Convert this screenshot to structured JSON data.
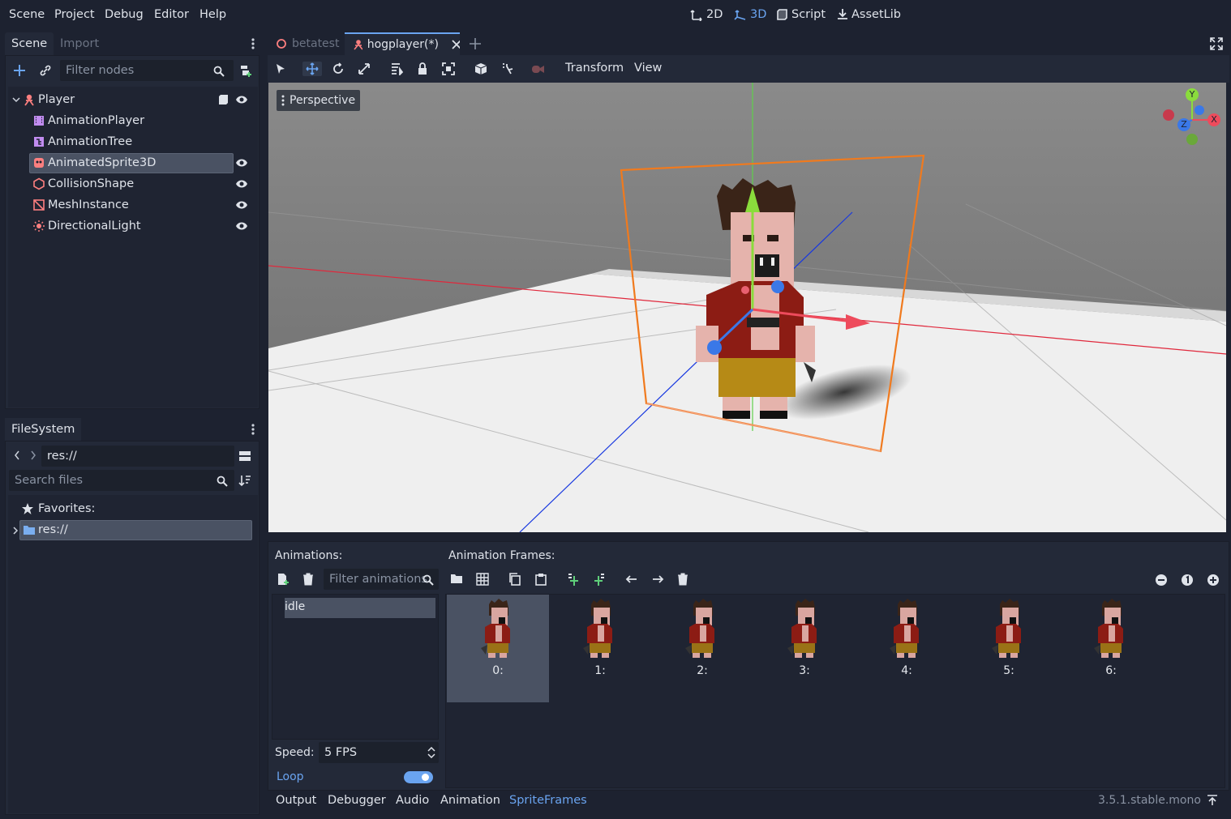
{
  "menu": {
    "scene": "Scene",
    "project": "Project",
    "debug": "Debug",
    "editor": "Editor",
    "help": "Help"
  },
  "workspaces": {
    "w2d": "2D",
    "w3d": "3D",
    "script": "Script",
    "assetlib": "AssetLib"
  },
  "scene_dock": {
    "tab_scene": "Scene",
    "tab_import": "Import",
    "filter_placeholder": "Filter nodes",
    "nodes": [
      {
        "label": "Player",
        "icon": "kinematic-body-icon"
      },
      {
        "label": "AnimationPlayer",
        "icon": "animation-player-icon"
      },
      {
        "label": "AnimationTree",
        "icon": "animation-tree-icon"
      },
      {
        "label": "AnimatedSprite3D",
        "icon": "animated-sprite-icon"
      },
      {
        "label": "CollisionShape",
        "icon": "collision-shape-icon"
      },
      {
        "label": "MeshInstance",
        "icon": "mesh-instance-icon"
      },
      {
        "label": "DirectionalLight",
        "icon": "directional-light-icon"
      }
    ]
  },
  "filesystem": {
    "tab": "FileSystem",
    "path": "res://",
    "search_placeholder": "Search files",
    "favorites": "Favorites:",
    "root": "res://"
  },
  "scene_tabs": [
    {
      "label": "betatest"
    },
    {
      "label": "hogplayer(*)"
    }
  ],
  "viewport_menu": {
    "transform": "Transform",
    "view": "View",
    "perspective": "Perspective"
  },
  "gizmo": {
    "x": "X",
    "y": "Y",
    "z": "Z"
  },
  "sprite_frames": {
    "animations_label": "Animations:",
    "filter_placeholder": "Filter animations",
    "animations": [
      "idle"
    ],
    "frames_label": "Animation Frames:",
    "frames": [
      "0:",
      "1:",
      "2:",
      "3:",
      "4:",
      "5:",
      "6:"
    ],
    "speed_label": "Speed:",
    "speed_value": "5 FPS",
    "loop_label": "Loop",
    "loop_on": true
  },
  "bottom_tabs": {
    "output": "Output",
    "debugger": "Debugger",
    "audio": "Audio",
    "animation": "Animation",
    "spriteframes": "SpriteFrames"
  },
  "version": "3.5.1.stable.mono",
  "colors": {
    "accent": "#6aa4f0",
    "selection": "#4a5263",
    "panel": "#232938",
    "background": "#1d2230"
  }
}
